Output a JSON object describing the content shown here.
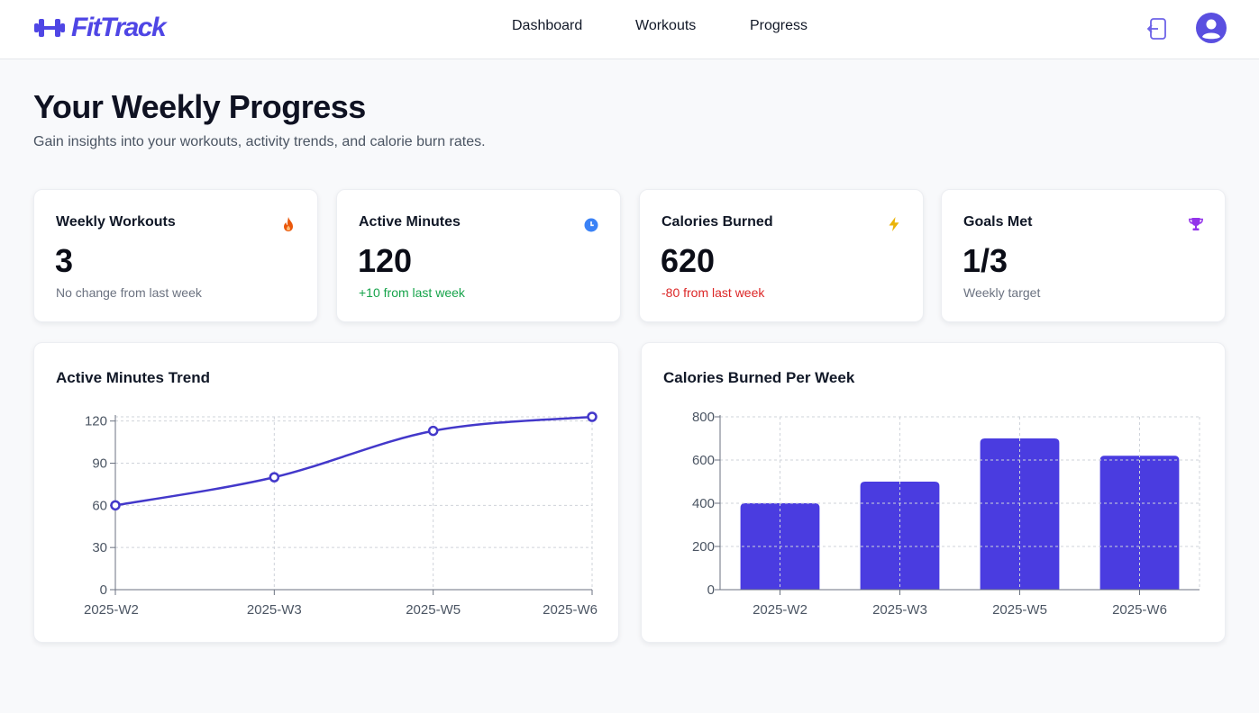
{
  "app": {
    "brand": "FitTrack",
    "brand_color": "#4f46e5"
  },
  "nav": {
    "dashboard": "Dashboard",
    "workouts": "Workouts",
    "progress": "Progress"
  },
  "header": {
    "logout_icon": "logout-icon",
    "avatar_icon": "user-avatar-icon"
  },
  "page": {
    "title": "Your Weekly Progress",
    "subtitle": "Gain insights into your workouts, activity trends, and calorie burn rates."
  },
  "stats": [
    {
      "label": "Weekly Workouts",
      "value": "3",
      "note": "No change from last week",
      "icon": "flame-icon",
      "icon_color": "#ea580c"
    },
    {
      "label": "Active Minutes",
      "value": "120",
      "note": "+10 from last week",
      "icon": "clock-icon",
      "icon_color": "#3b82f6"
    },
    {
      "label": "Calories Burned",
      "value": "620",
      "note": "-80 from last week",
      "icon": "lightning-icon",
      "icon_color": "#eab308"
    },
    {
      "label": "Goals Met",
      "value": "1/3",
      "note": "Weekly target",
      "icon": "trophy-icon",
      "icon_color": "#9333ea"
    }
  ],
  "chart_data": [
    {
      "type": "line",
      "title": "Active Minutes Trend",
      "categories": [
        "2025-W2",
        "2025-W3",
        "2025-W5",
        "2025-W6"
      ],
      "values": [
        60,
        80,
        113,
        123
      ],
      "yticks": [
        0,
        30,
        60,
        90,
        120
      ],
      "ylim": [
        0,
        123
      ],
      "grid": true,
      "color": "#4338ca"
    },
    {
      "type": "bar",
      "title": "Calories Burned Per Week",
      "categories": [
        "2025-W2",
        "2025-W3",
        "2025-W5",
        "2025-W6"
      ],
      "values": [
        400,
        500,
        700,
        620
      ],
      "yticks": [
        0,
        200,
        400,
        600,
        800
      ],
      "ylim": [
        0,
        800
      ],
      "grid": true,
      "color": "#4a3ce0"
    }
  ]
}
